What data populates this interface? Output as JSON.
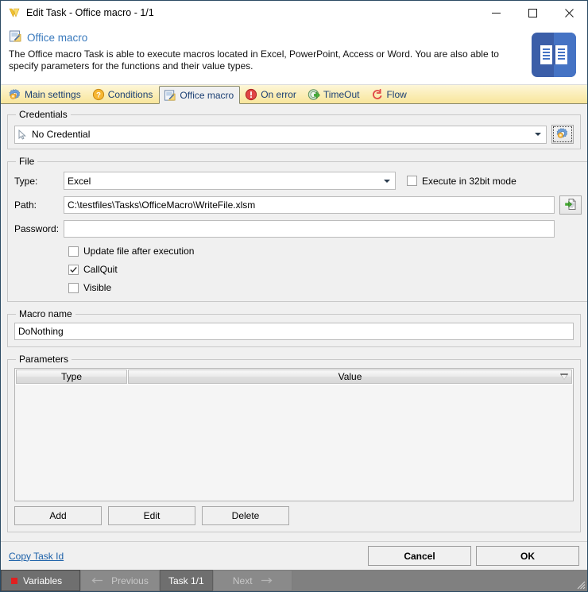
{
  "window": {
    "title": "Edit Task - Office macro - 1/1",
    "icon": "app-v-logo-icon",
    "minimize_label": "Minimize",
    "maximize_label": "Maximize",
    "close_label": "Close"
  },
  "header": {
    "title": "Office macro",
    "icon": "office-macro-icon",
    "description": "The Office macro Task is able to execute macros located in Excel, PowerPoint, Access or Word. You are also able to specify parameters for the functions and their value types.",
    "badge_icon": "book-document-icon"
  },
  "tabs": [
    {
      "label": "Main settings",
      "icon": "gear-icon",
      "active": false
    },
    {
      "label": "Conditions",
      "icon": "question-icon",
      "active": false
    },
    {
      "label": "Office macro",
      "icon": "office-macro-icon",
      "active": true
    },
    {
      "label": "On error",
      "icon": "error-icon",
      "active": false
    },
    {
      "label": "TimeOut",
      "icon": "timeout-icon",
      "active": false
    },
    {
      "label": "Flow",
      "icon": "flow-icon",
      "active": false
    }
  ],
  "credentials": {
    "legend": "Credentials",
    "selected": "No Credential",
    "cursor_icon": "cursor-arrow-icon",
    "manage_button_icon": "gear-settings-icon"
  },
  "file": {
    "legend": "File",
    "type_label": "Type:",
    "type_value": "Excel",
    "execute_32bit_label": "Execute in 32bit mode",
    "execute_32bit_checked": false,
    "path_label": "Path:",
    "path_value": "C:\\testfiles\\Tasks\\OfficeMacro\\WriteFile.xlsm",
    "browse_button_icon": "open-file-icon",
    "password_label": "Password:",
    "password_value": "",
    "checkboxes": [
      {
        "label": "Update file after execution",
        "checked": false
      },
      {
        "label": "CallQuit",
        "checked": true
      },
      {
        "label": "Visible",
        "checked": false
      }
    ]
  },
  "macro_name": {
    "legend": "Macro name",
    "value": "DoNothing"
  },
  "parameters": {
    "legend": "Parameters",
    "columns": [
      "Type",
      "Value"
    ],
    "rows": [],
    "buttons": [
      "Add",
      "Edit",
      "Delete"
    ]
  },
  "footer": {
    "copy_task_id": "Copy Task Id",
    "cancel": "Cancel",
    "ok": "OK"
  },
  "statusbar": {
    "variables": "Variables",
    "previous": "Previous",
    "task_count": "Task 1/1",
    "next": "Next"
  },
  "colors": {
    "accent_blue": "#3a7abd",
    "tab_text": "#1b3f73",
    "tabstrip_top": "#fdf6d8",
    "tabstrip_bottom": "#f8e59b",
    "link": "#1a5fa8",
    "statusbar_bg": "#808080",
    "badge_blue": "#3b5ea8",
    "red": "#e02020"
  }
}
